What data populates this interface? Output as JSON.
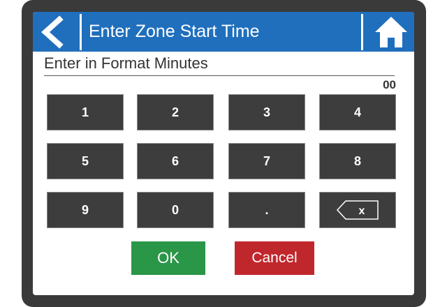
{
  "header": {
    "title": "Enter Zone Start Time",
    "back_icon": "chevron-left-icon",
    "home_icon": "home-icon"
  },
  "prompt": {
    "label": "Enter in Format Minutes",
    "value": "00"
  },
  "keypad": {
    "keys": [
      "1",
      "2",
      "3",
      "4",
      "5",
      "6",
      "7",
      "8",
      "9",
      "0",
      "."
    ],
    "backspace_label": "x"
  },
  "actions": {
    "ok_label": "OK",
    "cancel_label": "Cancel"
  },
  "colors": {
    "header": "#1f6fbd",
    "ok": "#2a9648",
    "cancel": "#c0272d",
    "key": "#3d3d3d",
    "bezel": "#3a3a3a"
  }
}
